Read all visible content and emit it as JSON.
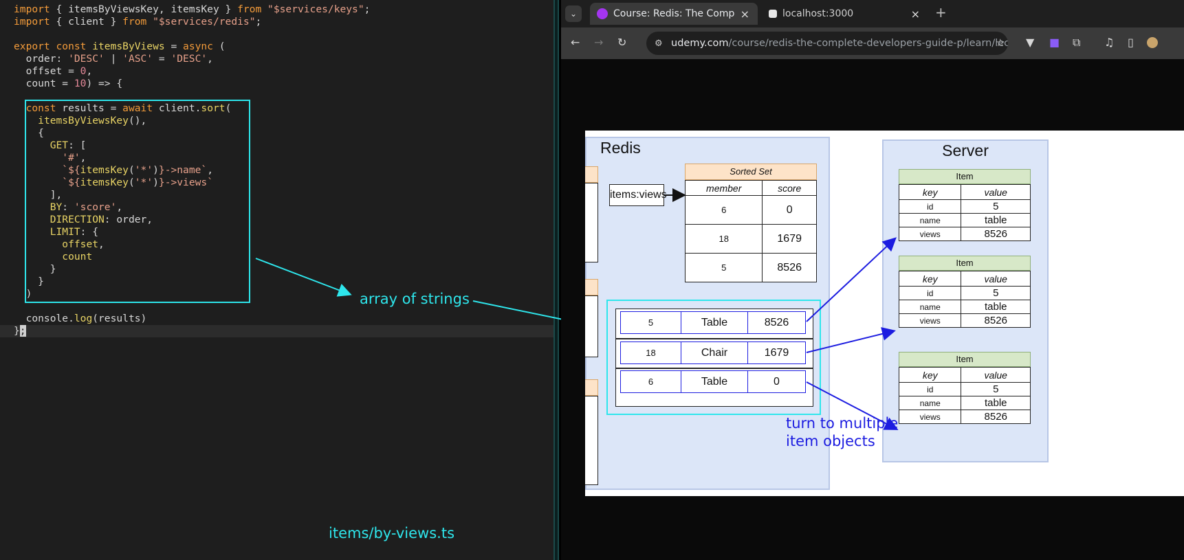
{
  "editor": {
    "file_label": "items/by-views.ts",
    "annotation": "array of strings"
  },
  "browser": {
    "tabs": [
      {
        "title": "Course: Redis: The Comp",
        "close": "×"
      },
      {
        "title": "localhost:3000",
        "close": "×"
      }
    ],
    "tab_menu": "⌄",
    "new_tab": "+",
    "url_host": "udemy.com",
    "url_path": "/course/redis-the-complete-developers-guide-p/learn/lecture..."
  },
  "slide": {
    "redis_title": "Redis",
    "server_title": "Server",
    "key_label": "items:views",
    "sorted_set": {
      "title": "Sorted Set",
      "headers": [
        "member",
        "score"
      ],
      "rows": [
        [
          "6",
          "0"
        ],
        [
          "18",
          "1679"
        ],
        [
          "5",
          "8526"
        ]
      ]
    },
    "results": [
      [
        "5",
        "Table",
        "8526"
      ],
      [
        "18",
        "Chair",
        "1679"
      ],
      [
        "6",
        "Table",
        "0"
      ]
    ],
    "items": [
      {
        "title": "Item",
        "headers": [
          "key",
          "value"
        ],
        "rows": [
          [
            "id",
            "5"
          ],
          [
            "name",
            "table"
          ],
          [
            "views",
            "8526"
          ]
        ]
      },
      {
        "title": "Item",
        "headers": [
          "key",
          "value"
        ],
        "rows": [
          [
            "id",
            "5"
          ],
          [
            "name",
            "table"
          ],
          [
            "views",
            "8526"
          ]
        ]
      },
      {
        "title": "Item",
        "headers": [
          "key",
          "value"
        ],
        "rows": [
          [
            "id",
            "5"
          ],
          [
            "name",
            "table"
          ],
          [
            "views",
            "8526"
          ]
        ]
      }
    ],
    "annotation_1": "turn to multiple",
    "annotation_2": "item objects"
  },
  "colors": {
    "annotation_cyan": "#2ee6ec",
    "annotation_blue": "#1c1ce0",
    "slide_panel": "#dce6f8"
  }
}
